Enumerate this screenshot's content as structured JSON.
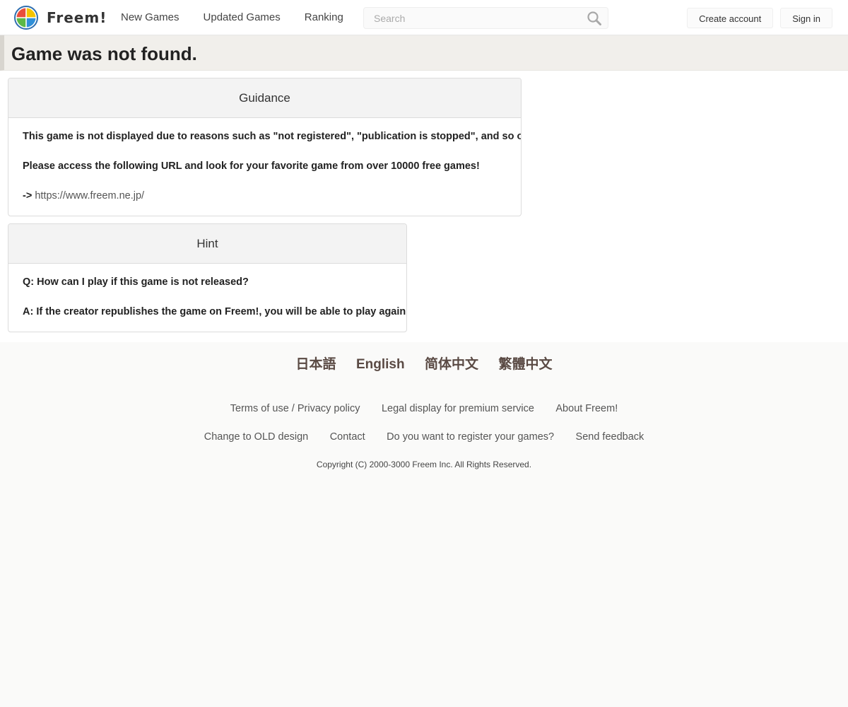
{
  "header": {
    "logo_text": "Freem!",
    "nav": [
      {
        "label": "New Games"
      },
      {
        "label": "Updated Games"
      },
      {
        "label": "Ranking"
      }
    ],
    "search": {
      "placeholder": "Search",
      "value": ""
    },
    "create_account_label": "Create account",
    "sign_in_label": "Sign in"
  },
  "page": {
    "title": "Game was not found."
  },
  "guidance": {
    "title": "Guidance",
    "line1": "This game is not displayed due to reasons such as \"not registered\", \"publication is stopped\", and so on.",
    "line2": "Please access the following URL and look for your favorite game from over 10000 free games!",
    "arrow": "-> ",
    "url": "https://www.freem.ne.jp/"
  },
  "hint": {
    "title": "Hint",
    "question": "Q: How can I play if this game is not released?",
    "answer": "A: If the creator republishes the game on Freem!, you will be able to play again."
  },
  "footer": {
    "languages": [
      {
        "label": "日本語"
      },
      {
        "label": "English"
      },
      {
        "label": "简体中文"
      },
      {
        "label": "繁體中文"
      }
    ],
    "links_row1": [
      {
        "label": "Terms of use / Privacy policy"
      },
      {
        "label": "Legal display for premium service"
      },
      {
        "label": "About Freem!"
      }
    ],
    "links_row2": [
      {
        "label": "Change to OLD design"
      },
      {
        "label": "Contact"
      },
      {
        "label": "Do you want to register your games?"
      },
      {
        "label": "Send feedback"
      }
    ],
    "copyright": "Copyright (C) 2000-3000 Freem Inc. All Rights Reserved."
  },
  "icons": {
    "logo": "freem-logo-icon",
    "search": "search-icon"
  },
  "colors": {
    "logo_red": "#e94e3c",
    "logo_yellow": "#f5c400",
    "logo_green": "#5bb946",
    "logo_blue": "#2f8fd8",
    "language_link": "#5a4a44"
  }
}
